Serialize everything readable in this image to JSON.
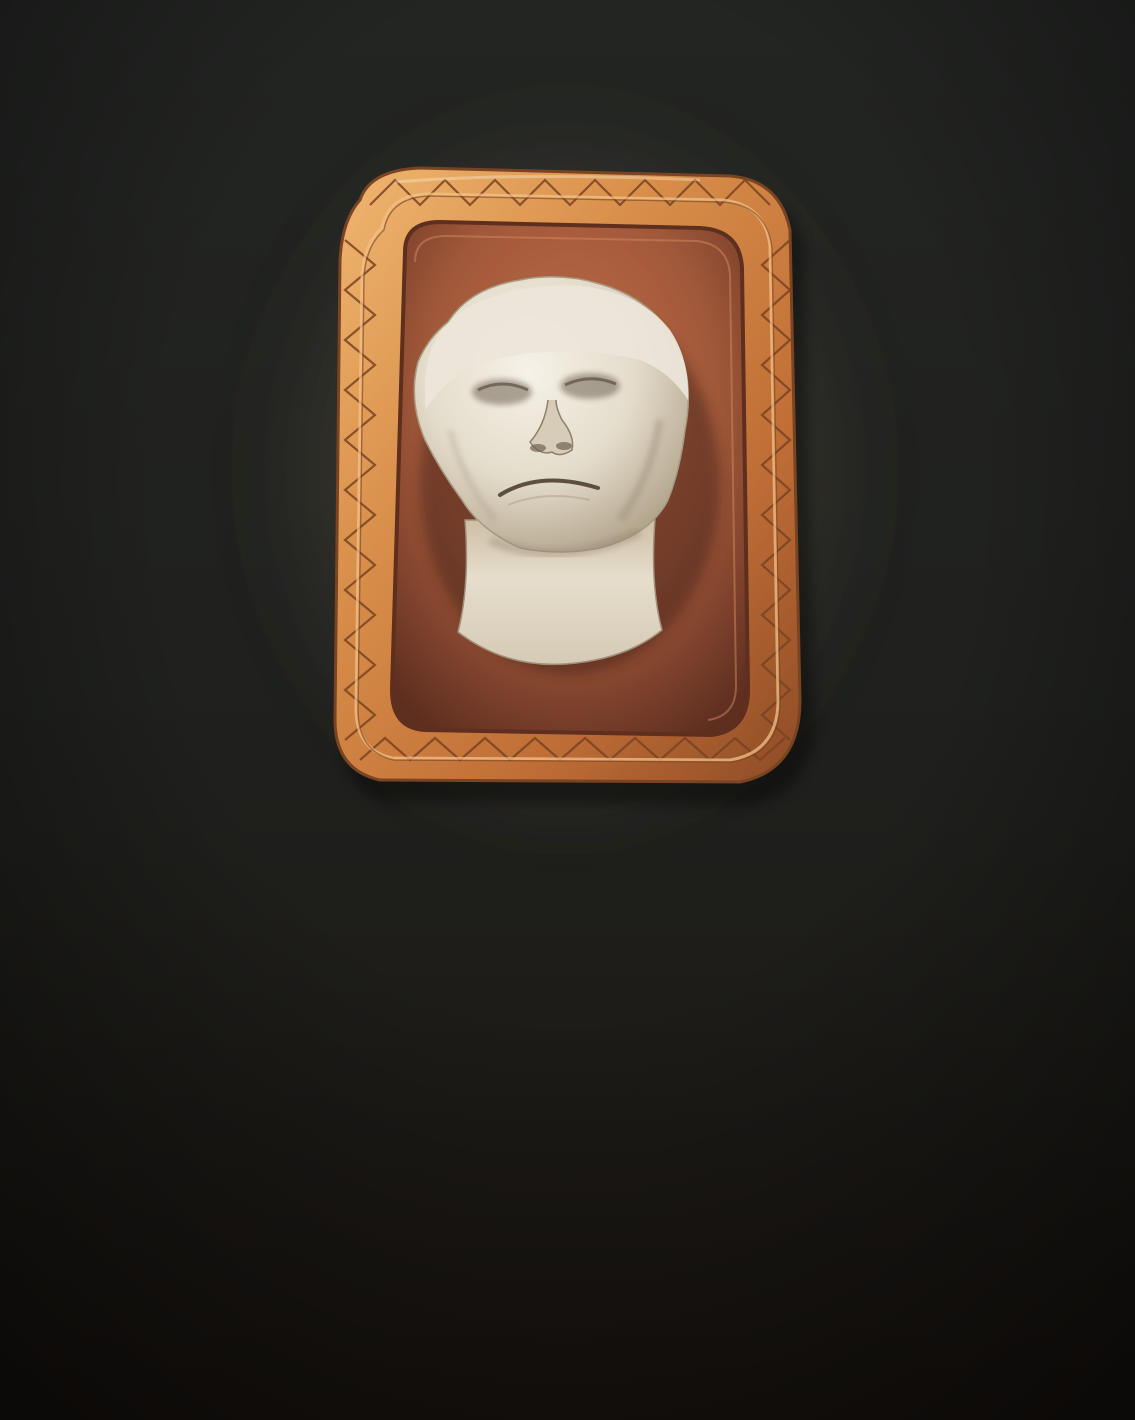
{
  "scene": {
    "subject": "cameo-plaque",
    "colors": {
      "background_top": "#232523",
      "background_mid": "#1f201d",
      "background_bottom": "#1a1511",
      "glow": "#8a7c5e",
      "frame_gold_light": "#e7a560",
      "frame_gold_mid": "#c97d3b",
      "frame_gold_dark": "#7a4322",
      "recess_copper": "#a1583a",
      "recess_dark": "#5e2e1f",
      "bust_light": "#f0ebe0",
      "bust_mid": "#d8cfbd",
      "bust_shadow": "#9f9078"
    }
  }
}
